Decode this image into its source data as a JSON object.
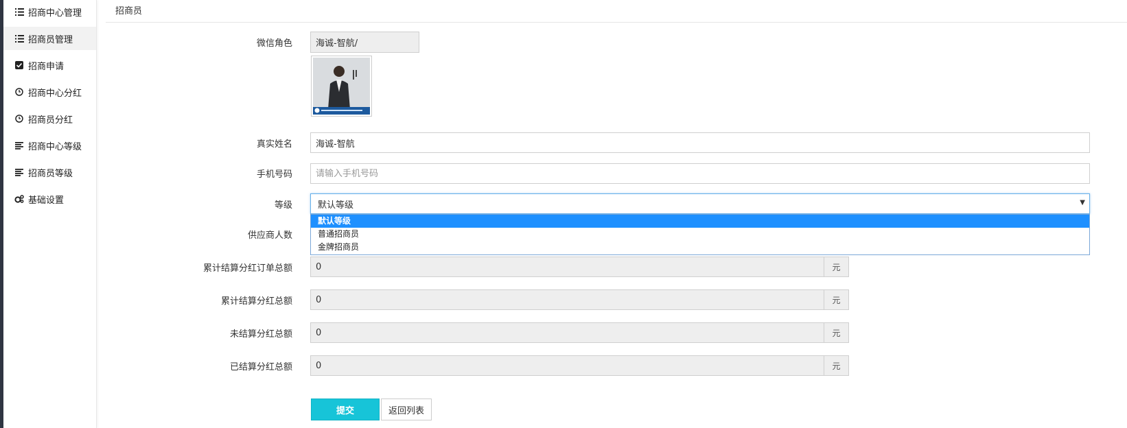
{
  "sidebar": {
    "items": [
      {
        "label": "招商中心管理",
        "icon": "list-icon"
      },
      {
        "label": "招商员管理",
        "icon": "list-icon"
      },
      {
        "label": "招商申请",
        "icon": "checkbox-icon"
      },
      {
        "label": "招商中心分红",
        "icon": "clock-icon"
      },
      {
        "label": "招商员分红",
        "icon": "clock-icon"
      },
      {
        "label": "招商中心等级",
        "icon": "align-left-icon"
      },
      {
        "label": "招商员等级",
        "icon": "align-left-icon"
      },
      {
        "label": "基础设置",
        "icon": "gears-icon"
      }
    ]
  },
  "page": {
    "title": "招商员"
  },
  "form": {
    "wechat_role": {
      "label": "微信角色",
      "value": "海诚-智航/"
    },
    "real_name": {
      "label": "真实姓名",
      "value": "海诚-智航"
    },
    "phone": {
      "label": "手机号码",
      "placeholder": "请输入手机号码"
    },
    "level": {
      "label": "等级",
      "selected": "默认等级",
      "options": [
        "默认等级",
        "普通招商员",
        "金牌招商员"
      ]
    },
    "supplier_count": {
      "label": "供应商人数"
    },
    "total_settled_order_amount": {
      "label": "累计结算分红订单总额",
      "value": "0",
      "unit": "元"
    },
    "total_settled_bonus": {
      "label": "累计结算分红总额",
      "value": "0",
      "unit": "元"
    },
    "unsettled_bonus": {
      "label": "未结算分红总额",
      "value": "0",
      "unit": "元"
    },
    "settled_bonus": {
      "label": "已结算分红总额",
      "value": "0",
      "unit": "元"
    }
  },
  "buttons": {
    "submit": "提交",
    "back": "返回列表"
  },
  "colors": {
    "accent": "#17c4d8",
    "dropdown_highlight": "#1e90ff",
    "sidebar_strip": "#2f3542"
  }
}
